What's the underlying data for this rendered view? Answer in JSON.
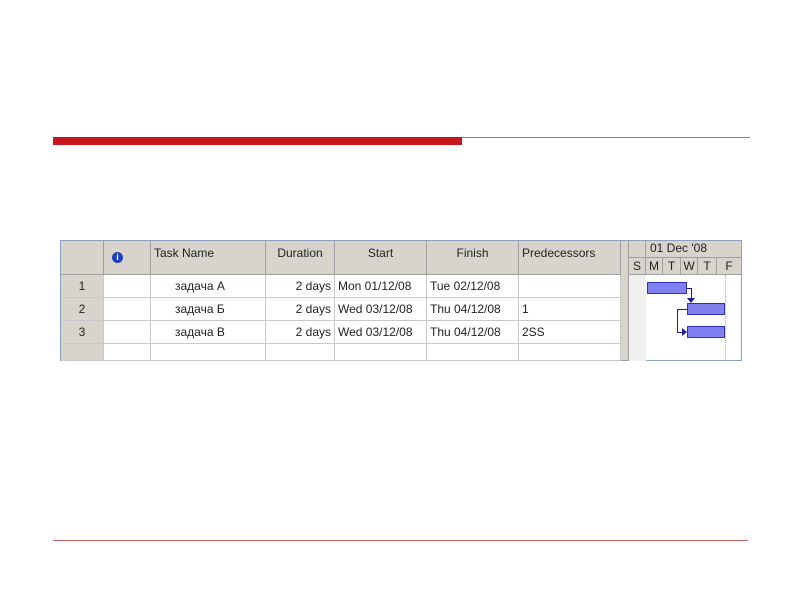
{
  "table": {
    "headers": {
      "info": "i",
      "task_name": "Task Name",
      "duration": "Duration",
      "start": "Start",
      "finish": "Finish",
      "predecessors": "Predecessors"
    },
    "rows": [
      {
        "id": "1",
        "name": "задача А",
        "duration": "2 days",
        "start": "Mon 01/12/08",
        "finish": "Tue 02/12/08",
        "pred": ""
      },
      {
        "id": "2",
        "name": "задача Б",
        "duration": "2 days",
        "start": "Wed 03/12/08",
        "finish": "Thu 04/12/08",
        "pred": "1"
      },
      {
        "id": "3",
        "name": "задача В",
        "duration": "2 days",
        "start": "Wed 03/12/08",
        "finish": "Thu 04/12/08",
        "pred": "2SS"
      }
    ]
  },
  "gantt": {
    "week": "01 Dec '08",
    "days": [
      "S",
      "M",
      "T",
      "W",
      "T",
      "F"
    ],
    "bar_color": "#8080f0"
  },
  "colors": {
    "accent": "#c8161d"
  }
}
